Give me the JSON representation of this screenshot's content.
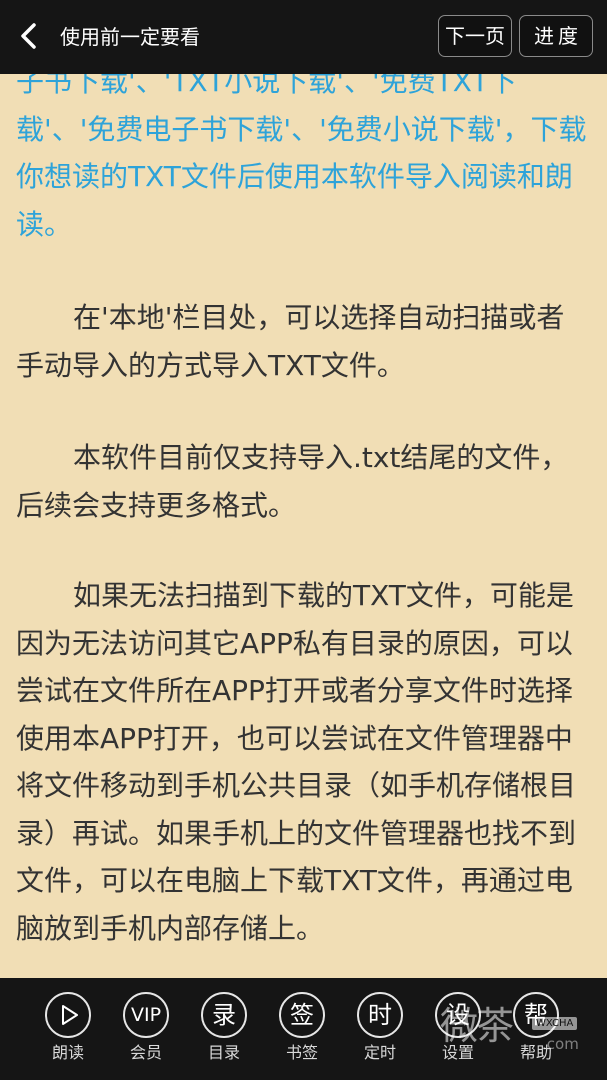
{
  "header": {
    "title": "使用前一定要看",
    "next_label": "下一页",
    "progress_label": "进度"
  },
  "content": {
    "paragraphs": [
      "子书下载'、'TXT小说下载'、'免费TXT下载'、'免费电子书下载'、'免费小说下载'，下载你想读的TXT文件后使用本软件导入阅读和朗读。",
      "在'本地'栏目处，可以选择自动扫描或者手动导入的方式导入TXT文件。",
      "本软件目前仅支持导入.txt结尾的文件，后续会支持更多格式。",
      "如果无法扫描到下载的TXT文件，可能是因为无法访问其它APP私有目录的原因，可以尝试在文件所在APP打开或者分享文件时选择使用本APP打开，也可以尝试在文件管理器中将文件移动到手机公共目录（如手机存储根目录）再试。如果手机上的文件管理器也找不到文件，可以在电脑上下载TXT文件，再通过电脑放到手机内部存储上。"
    ]
  },
  "toolbar": {
    "items": [
      {
        "icon": "play-icon",
        "glyph": "",
        "label": "朗读"
      },
      {
        "icon": "vip-icon",
        "glyph": "VIP",
        "label": "会员"
      },
      {
        "icon": "catalog-icon",
        "glyph": "录",
        "label": "目录"
      },
      {
        "icon": "bookmark-icon",
        "glyph": "签",
        "label": "书签"
      },
      {
        "icon": "timer-icon",
        "glyph": "时",
        "label": "定时"
      },
      {
        "icon": "settings-icon",
        "glyph": "设",
        "label": "设置"
      },
      {
        "icon": "help-icon",
        "glyph": "帮",
        "label": "帮助"
      }
    ]
  },
  "watermark": {
    "text": "微茶",
    "tag": "WXCHA",
    "domain": ".com"
  },
  "colors": {
    "page_background": "#f1deb5",
    "link_text": "#2ea3d9",
    "body_text": "#333333",
    "bar_background": "#151515"
  }
}
